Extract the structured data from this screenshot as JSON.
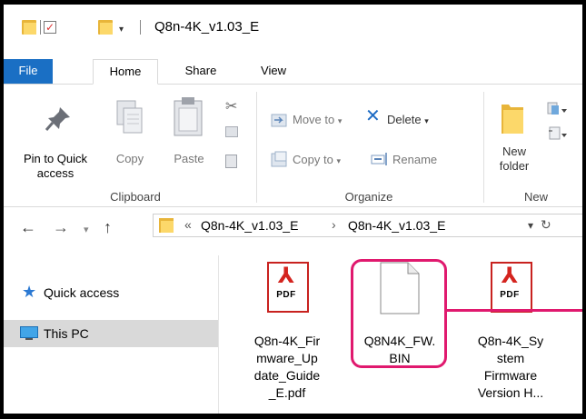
{
  "window": {
    "title": "Q8n-4K_v1.03_E"
  },
  "tabs": {
    "file": "File",
    "home": "Home",
    "share": "Share",
    "view": "View"
  },
  "ribbon": {
    "clipboard": {
      "pin_label_1": "Pin to Quick",
      "pin_label_2": "access",
      "copy": "Copy",
      "paste": "Paste",
      "group": "Clipboard"
    },
    "organize": {
      "move_to": "Move to",
      "delete": "Delete",
      "copy_to": "Copy to",
      "rename": "Rename",
      "group": "Organize"
    },
    "new": {
      "new_folder_1": "New",
      "new_folder_2": "folder",
      "group": "New"
    }
  },
  "address": {
    "overflow": "«",
    "crumbs": [
      "Q8n-4K_v1.03_E",
      "Q8n-4K_v1.03_E"
    ],
    "separator": "›"
  },
  "nav_pane": {
    "items": [
      {
        "label": "Quick access",
        "icon": "star-icon"
      },
      {
        "label": "This PC",
        "icon": "computer-icon"
      }
    ]
  },
  "files": [
    {
      "name_lines": [
        "Q8n-4K_Fir",
        "mware_Up",
        "date_Guide",
        "_E.pdf"
      ],
      "type": "pdf",
      "badge": "PDF"
    },
    {
      "name_lines": [
        "Q8N4K_FW.",
        "BIN"
      ],
      "type": "bin"
    },
    {
      "name_lines": [
        "Q8n-4K_Sy",
        "stem",
        "Firmware",
        "Version H..."
      ],
      "type": "pdf",
      "badge": "PDF"
    }
  ],
  "colors": {
    "accent": "#1a6fc4",
    "highlight": "#e0196e",
    "pdf": "#d4241f"
  }
}
